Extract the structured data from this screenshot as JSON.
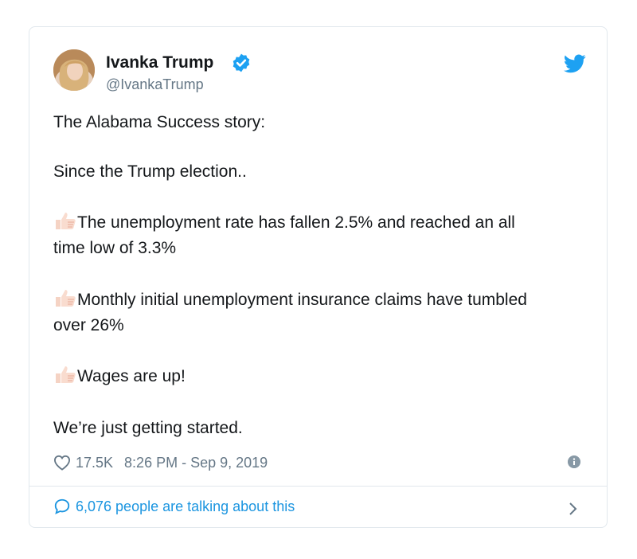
{
  "tweet": {
    "author_name": "Ivanka Trump",
    "handle": "@IvankaTrump",
    "lines": [
      "The Alabama Success story:",
      "Since the Trump election..",
      "The unemployment rate has fallen 2.5% and reached an all",
      "time low of 3.3%",
      "Monthly initial unemployment insurance claims have tumbled",
      "over 26%",
      "Wages are up!",
      "We’re just getting started."
    ],
    "likes": "17.5K",
    "timestamp": "8:26 PM - Sep 9, 2019",
    "talking": "6,076 people are talking about this"
  },
  "colors": {
    "accent": "#1da1f2",
    "link": "#1b95e0",
    "muted": "#657786",
    "border": "#e1e8ed"
  },
  "icons": [
    "verified-badge-icon",
    "twitter-bird-icon",
    "thumbs-up-icon",
    "heart-icon",
    "info-icon",
    "comment-bubble-icon",
    "chevron-right-icon"
  ]
}
